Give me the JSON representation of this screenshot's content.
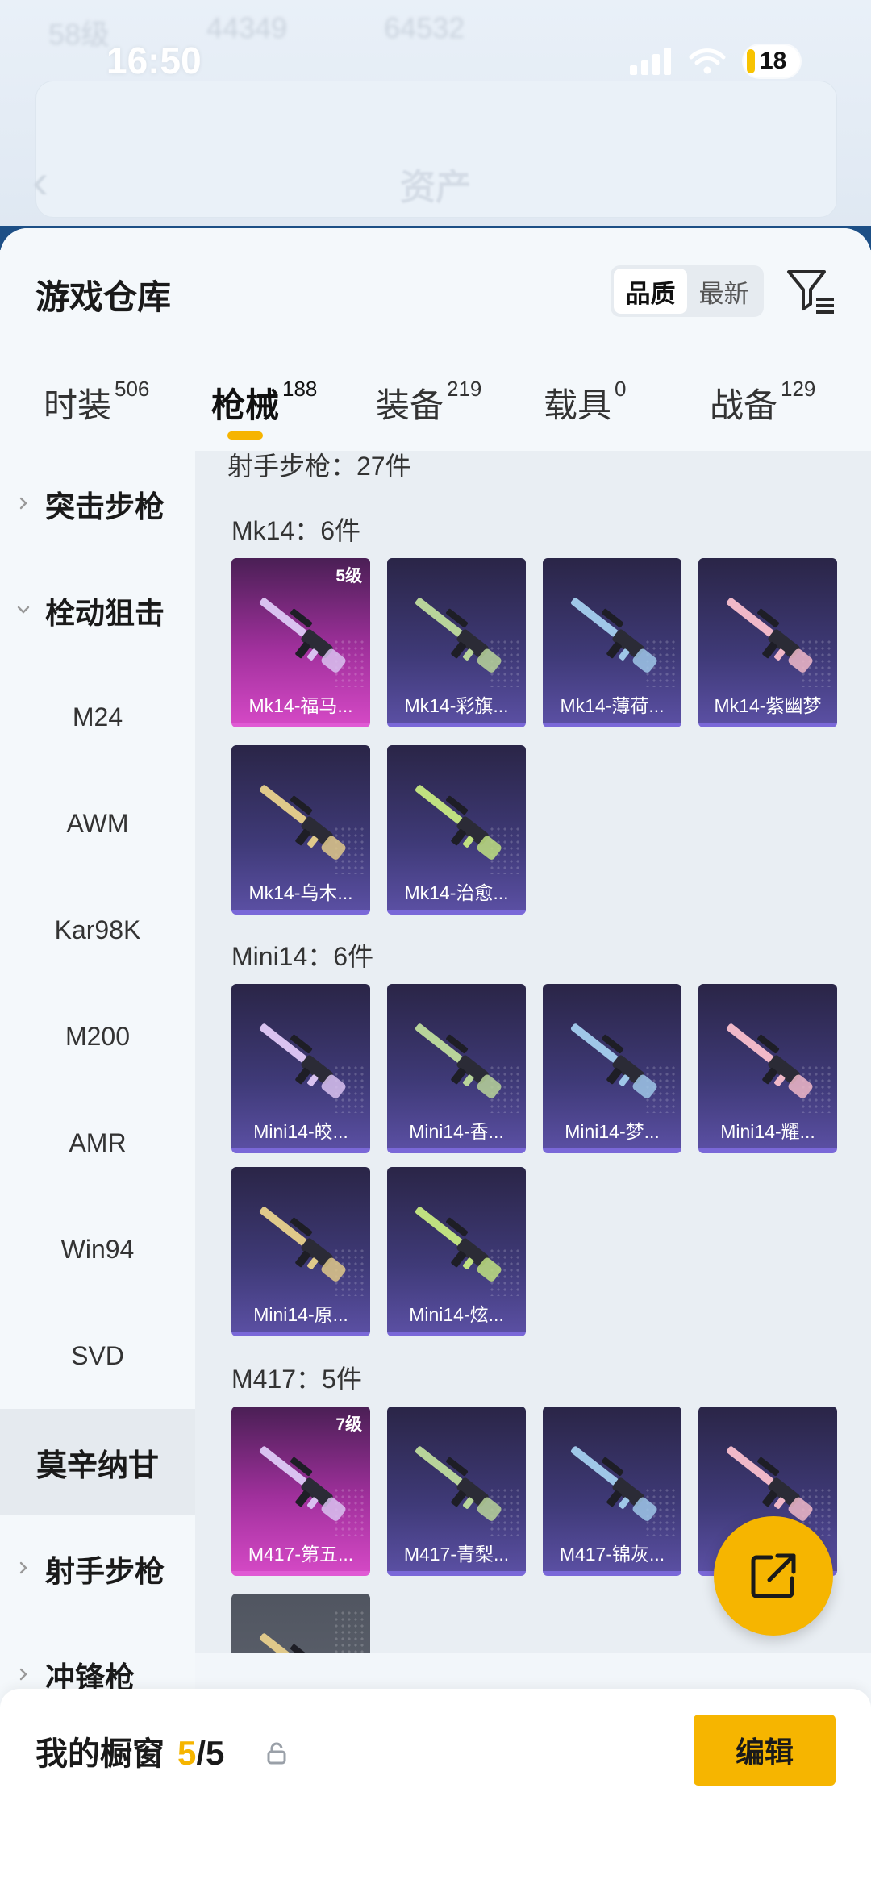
{
  "status_bar": {
    "time": "16:50",
    "battery": "18"
  },
  "background_header": {
    "title": "资产",
    "blur_texts": [
      "58级",
      "44349",
      "64532"
    ]
  },
  "colors": {
    "accent": "#f6b500",
    "legend_card": "#b0359f",
    "epic_card": "#3f3a78"
  },
  "warehouse": {
    "title": "游戏仓库",
    "sort_options": [
      "品质",
      "最新"
    ],
    "active_sort": "品质",
    "filter_icon": "filter-icon"
  },
  "tabs": [
    {
      "label": "时装",
      "count": "506"
    },
    {
      "label": "枪械",
      "count": "188"
    },
    {
      "label": "装备",
      "count": "219"
    },
    {
      "label": "载具",
      "count": "0"
    },
    {
      "label": "战备",
      "count": "129"
    }
  ],
  "active_tab": "枪械",
  "sidebar": {
    "assault": "突击步枪",
    "bolt_action": "栓动狙击",
    "sub_items": [
      "M24",
      "AWM",
      "Kar98K",
      "M200",
      "AMR",
      "Win94",
      "SVD"
    ],
    "selected": "莫辛纳甘",
    "marksman": "射手步枪",
    "smg": "冲锋枪"
  },
  "content": {
    "section_header": "射手步枪：27件",
    "groups": [
      {
        "label": "Mk14：6件",
        "items": [
          {
            "name": "Mk14-福马...",
            "level": "5级",
            "rarity": "legend"
          },
          {
            "name": "Mk14-彩旗...",
            "level": "",
            "rarity": "epic"
          },
          {
            "name": "Mk14-薄荷...",
            "level": "",
            "rarity": "epic"
          },
          {
            "name": "Mk14-紫幽梦",
            "level": "",
            "rarity": "epic"
          },
          {
            "name": "Mk14-乌木...",
            "level": "",
            "rarity": "epic"
          },
          {
            "name": "Mk14-治愈...",
            "level": "",
            "rarity": "epic"
          }
        ]
      },
      {
        "label": "Mini14：6件",
        "items": [
          {
            "name": "Mini14-皎...",
            "level": "",
            "rarity": "epic"
          },
          {
            "name": "Mini14-香...",
            "level": "",
            "rarity": "epic"
          },
          {
            "name": "Mini14-梦...",
            "level": "",
            "rarity": "epic"
          },
          {
            "name": "Mini14-耀...",
            "level": "",
            "rarity": "epic"
          },
          {
            "name": "Mini14-原...",
            "level": "",
            "rarity": "epic"
          },
          {
            "name": "Mini14-炫...",
            "level": "",
            "rarity": "epic"
          }
        ]
      },
      {
        "label": "M417：5件",
        "items": [
          {
            "name": "M417-第五...",
            "level": "7级",
            "rarity": "legend"
          },
          {
            "name": "M417-青梨...",
            "level": "",
            "rarity": "epic"
          },
          {
            "name": "M417-锦灰...",
            "level": "",
            "rarity": "epic"
          },
          {
            "name": "M",
            "level": "",
            "rarity": "epic"
          },
          {
            "name": "",
            "level": "",
            "rarity": "grey"
          }
        ]
      }
    ]
  },
  "showcase": {
    "title": "我的橱窗",
    "current": "5",
    "separator": "/",
    "max": "5",
    "edit_label": "编辑"
  }
}
